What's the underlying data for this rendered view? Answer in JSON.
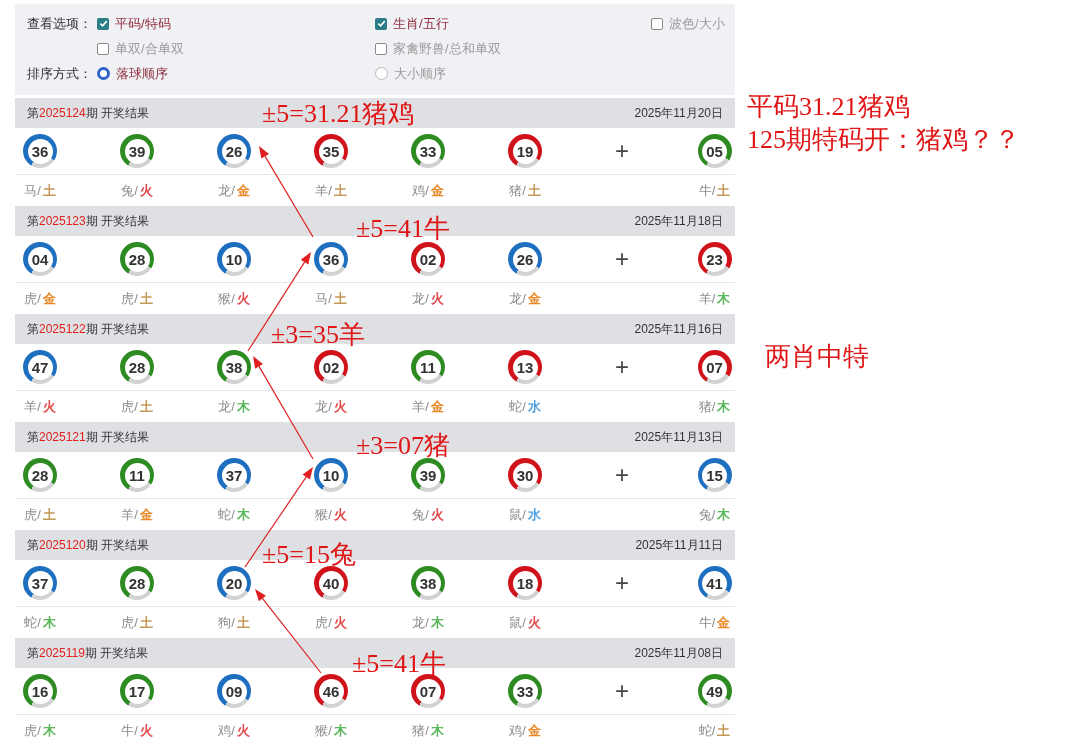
{
  "options": {
    "view": {
      "label": "查看选项：",
      "items": [
        {
          "label": "平码/特码",
          "checked": true
        },
        {
          "label": "生肖/五行",
          "checked": true
        },
        {
          "label": "波色/大小",
          "checked": false
        },
        {
          "label": "单双/合单双",
          "checked": false
        },
        {
          "label": "家禽野兽/总和单双",
          "checked": false
        }
      ]
    },
    "sort": {
      "label": "排序方式：",
      "items": [
        {
          "label": "落球顺序",
          "selected": true
        },
        {
          "label": "大小顺序",
          "selected": false
        }
      ]
    }
  },
  "draws": [
    {
      "title_prefix": "第",
      "issue": "2025124",
      "title_suffix": "期 开奖结果",
      "date": "2025年11月20日",
      "plus": "+",
      "balls": [
        {
          "number": "36",
          "color": "#1f6fc1",
          "zodiac": "马",
          "slash": "/",
          "element": {
            "text": "土",
            "color": "#c49a5a"
          }
        },
        {
          "number": "39",
          "color": "#2e8b22",
          "zodiac": "兔",
          "slash": "/",
          "element": {
            "text": "火",
            "color": "#e34a4a"
          }
        },
        {
          "number": "26",
          "color": "#1f6fc1",
          "zodiac": "龙",
          "slash": "/",
          "element": {
            "text": "金",
            "color": "#e88a2a"
          }
        },
        {
          "number": "35",
          "color": "#d0121a",
          "zodiac": "羊",
          "slash": "/",
          "element": {
            "text": "土",
            "color": "#c49a5a"
          }
        },
        {
          "number": "33",
          "color": "#2e8b22",
          "zodiac": "鸡",
          "slash": "/",
          "element": {
            "text": "金",
            "color": "#e88a2a"
          }
        },
        {
          "number": "19",
          "color": "#d0121a",
          "zodiac": "猪",
          "slash": "/",
          "element": {
            "text": "土",
            "color": "#c49a5a"
          }
        }
      ],
      "special": {
        "number": "05",
        "color": "#2e8b22",
        "zodiac": "牛",
        "slash": "/",
        "element": {
          "text": "土",
          "color": "#c49a5a"
        }
      }
    },
    {
      "title_prefix": "第",
      "issue": "2025123",
      "title_suffix": "期 开奖结果",
      "date": "2025年11月18日",
      "plus": "+",
      "balls": [
        {
          "number": "04",
          "color": "#1f6fc1",
          "zodiac": "虎",
          "slash": "/",
          "element": {
            "text": "金",
            "color": "#e88a2a"
          }
        },
        {
          "number": "28",
          "color": "#2e8b22",
          "zodiac": "虎",
          "slash": "/",
          "element": {
            "text": "土",
            "color": "#c49a5a"
          }
        },
        {
          "number": "10",
          "color": "#1f6fc1",
          "zodiac": "猴",
          "slash": "/",
          "element": {
            "text": "火",
            "color": "#e34a4a"
          }
        },
        {
          "number": "36",
          "color": "#1f6fc1",
          "zodiac": "马",
          "slash": "/",
          "element": {
            "text": "土",
            "color": "#c49a5a"
          }
        },
        {
          "number": "02",
          "color": "#d0121a",
          "zodiac": "龙",
          "slash": "/",
          "element": {
            "text": "火",
            "color": "#e34a4a"
          }
        },
        {
          "number": "26",
          "color": "#1f6fc1",
          "zodiac": "龙",
          "slash": "/",
          "element": {
            "text": "金",
            "color": "#e88a2a"
          }
        }
      ],
      "special": {
        "number": "23",
        "color": "#d0121a",
        "zodiac": "羊",
        "slash": "/",
        "element": {
          "text": "木",
          "color": "#5cb85c"
        }
      }
    },
    {
      "title_prefix": "第",
      "issue": "2025122",
      "title_suffix": "期 开奖结果",
      "date": "2025年11月16日",
      "plus": "+",
      "balls": [
        {
          "number": "47",
          "color": "#1f6fc1",
          "zodiac": "羊",
          "slash": "/",
          "element": {
            "text": "火",
            "color": "#e34a4a"
          }
        },
        {
          "number": "28",
          "color": "#2e8b22",
          "zodiac": "虎",
          "slash": "/",
          "element": {
            "text": "土",
            "color": "#c49a5a"
          }
        },
        {
          "number": "38",
          "color": "#2e8b22",
          "zodiac": "龙",
          "slash": "/",
          "element": {
            "text": "木",
            "color": "#5cb85c"
          }
        },
        {
          "number": "02",
          "color": "#d0121a",
          "zodiac": "龙",
          "slash": "/",
          "element": {
            "text": "火",
            "color": "#e34a4a"
          }
        },
        {
          "number": "11",
          "color": "#2e8b22",
          "zodiac": "羊",
          "slash": "/",
          "element": {
            "text": "金",
            "color": "#e88a2a"
          }
        },
        {
          "number": "13",
          "color": "#d0121a",
          "zodiac": "蛇",
          "slash": "/",
          "element": {
            "text": "水",
            "color": "#4a9ee0"
          }
        }
      ],
      "special": {
        "number": "07",
        "color": "#d0121a",
        "zodiac": "猪",
        "slash": "/",
        "element": {
          "text": "木",
          "color": "#5cb85c"
        }
      }
    },
    {
      "title_prefix": "第",
      "issue": "2025121",
      "title_suffix": "期 开奖结果",
      "date": "2025年11月13日",
      "plus": "+",
      "balls": [
        {
          "number": "28",
          "color": "#2e8b22",
          "zodiac": "虎",
          "slash": "/",
          "element": {
            "text": "土",
            "color": "#c49a5a"
          }
        },
        {
          "number": "11",
          "color": "#2e8b22",
          "zodiac": "羊",
          "slash": "/",
          "element": {
            "text": "金",
            "color": "#e88a2a"
          }
        },
        {
          "number": "37",
          "color": "#1f6fc1",
          "zodiac": "蛇",
          "slash": "/",
          "element": {
            "text": "木",
            "color": "#5cb85c"
          }
        },
        {
          "number": "10",
          "color": "#1f6fc1",
          "zodiac": "猴",
          "slash": "/",
          "element": {
            "text": "火",
            "color": "#e34a4a"
          }
        },
        {
          "number": "39",
          "color": "#2e8b22",
          "zodiac": "兔",
          "slash": "/",
          "element": {
            "text": "火",
            "color": "#e34a4a"
          }
        },
        {
          "number": "30",
          "color": "#d0121a",
          "zodiac": "鼠",
          "slash": "/",
          "element": {
            "text": "水",
            "color": "#4a9ee0"
          }
        }
      ],
      "special": {
        "number": "15",
        "color": "#1f6fc1",
        "zodiac": "兔",
        "slash": "/",
        "element": {
          "text": "木",
          "color": "#5cb85c"
        }
      }
    },
    {
      "title_prefix": "第",
      "issue": "2025120",
      "title_suffix": "期 开奖结果",
      "date": "2025年11月11日",
      "plus": "+",
      "balls": [
        {
          "number": "37",
          "color": "#1f6fc1",
          "zodiac": "蛇",
          "slash": "/",
          "element": {
            "text": "木",
            "color": "#5cb85c"
          }
        },
        {
          "number": "28",
          "color": "#2e8b22",
          "zodiac": "虎",
          "slash": "/",
          "element": {
            "text": "土",
            "color": "#c49a5a"
          }
        },
        {
          "number": "20",
          "color": "#1f6fc1",
          "zodiac": "狗",
          "slash": "/",
          "element": {
            "text": "土",
            "color": "#c49a5a"
          }
        },
        {
          "number": "40",
          "color": "#d0121a",
          "zodiac": "虎",
          "slash": "/",
          "element": {
            "text": "火",
            "color": "#e34a4a"
          }
        },
        {
          "number": "38",
          "color": "#2e8b22",
          "zodiac": "龙",
          "slash": "/",
          "element": {
            "text": "木",
            "color": "#5cb85c"
          }
        },
        {
          "number": "18",
          "color": "#d0121a",
          "zodiac": "鼠",
          "slash": "/",
          "element": {
            "text": "火",
            "color": "#e34a4a"
          }
        }
      ],
      "special": {
        "number": "41",
        "color": "#1f6fc1",
        "zodiac": "牛",
        "slash": "/",
        "element": {
          "text": "金",
          "color": "#e88a2a"
        }
      }
    },
    {
      "title_prefix": "第",
      "issue": "2025119",
      "title_suffix": "期 开奖结果",
      "date": "2025年11月08日",
      "plus": "+",
      "balls": [
        {
          "number": "16",
          "color": "#2e8b22",
          "zodiac": "虎",
          "slash": "/",
          "element": {
            "text": "木",
            "color": "#5cb85c"
          }
        },
        {
          "number": "17",
          "color": "#2e8b22",
          "zodiac": "牛",
          "slash": "/",
          "element": {
            "text": "火",
            "color": "#e34a4a"
          }
        },
        {
          "number": "09",
          "color": "#1f6fc1",
          "zodiac": "鸡",
          "slash": "/",
          "element": {
            "text": "火",
            "color": "#e34a4a"
          }
        },
        {
          "number": "46",
          "color": "#d0121a",
          "zodiac": "猴",
          "slash": "/",
          "element": {
            "text": "木",
            "color": "#5cb85c"
          }
        },
        {
          "number": "07",
          "color": "#d0121a",
          "zodiac": "猪",
          "slash": "/",
          "element": {
            "text": "木",
            "color": "#5cb85c"
          }
        },
        {
          "number": "33",
          "color": "#2e8b22",
          "zodiac": "鸡",
          "slash": "/",
          "element": {
            "text": "金",
            "color": "#e88a2a"
          }
        }
      ],
      "special": {
        "number": "49",
        "color": "#2e8b22",
        "zodiac": "蛇",
        "slash": "/",
        "element": {
          "text": "土",
          "color": "#c49a5a"
        }
      }
    }
  ],
  "annotations": {
    "labels": [
      "±5=31.21猪鸡",
      "±5=41牛",
      "±3=35羊",
      "±3=07猪",
      "±5=15兔",
      "±5=41牛"
    ],
    "notes": [
      "平码31.21猪鸡",
      "125期特码开：猪鸡？？",
      "两肖中特"
    ]
  }
}
